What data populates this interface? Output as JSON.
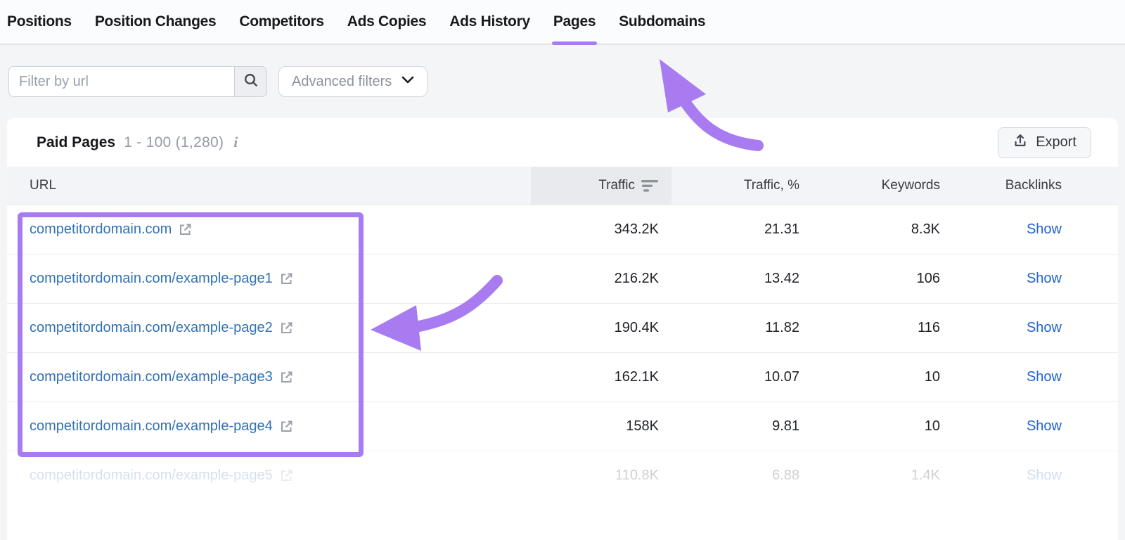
{
  "nav": {
    "tabs": [
      {
        "label": "Positions",
        "active": false
      },
      {
        "label": "Position Changes",
        "active": false
      },
      {
        "label": "Competitors",
        "active": false
      },
      {
        "label": "Ads Copies",
        "active": false
      },
      {
        "label": "Ads History",
        "active": false
      },
      {
        "label": "Pages",
        "active": true
      },
      {
        "label": "Subdomains",
        "active": false
      }
    ]
  },
  "filters": {
    "url_filter_placeholder": "Filter by url",
    "url_filter_value": "",
    "search_icon": "magnifier-icon",
    "advanced_filters_label": "Advanced filters",
    "advanced_filters_icon": "chevron-down-icon"
  },
  "table": {
    "title": "Paid Pages",
    "range_label": "1 - 100 (1,280)",
    "info_icon": "info-icon",
    "export_label": "Export",
    "export_icon": "upload-icon",
    "columns": {
      "url": "URL",
      "traffic": "Traffic",
      "traffic_pct": "Traffic, %",
      "keywords": "Keywords",
      "backlinks": "Backlinks"
    },
    "sorted_by": "Traffic",
    "sort_icon": "sort-descending-icon",
    "external_link_icon": "external-link-icon",
    "rows": [
      {
        "url": "competitordomain.com",
        "traffic": "343.2K",
        "traffic_pct": "21.31",
        "keywords": "8.3K",
        "backlinks_label": "Show"
      },
      {
        "url": "competitordomain.com/example-page1",
        "traffic": "216.2K",
        "traffic_pct": "13.42",
        "keywords": "106",
        "backlinks_label": "Show"
      },
      {
        "url": "competitordomain.com/example-page2",
        "traffic": "190.4K",
        "traffic_pct": "11.82",
        "keywords": "116",
        "backlinks_label": "Show"
      },
      {
        "url": "competitordomain.com/example-page3",
        "traffic": "162.1K",
        "traffic_pct": "10.07",
        "keywords": "10",
        "backlinks_label": "Show"
      },
      {
        "url": "competitordomain.com/example-page4",
        "traffic": "158K",
        "traffic_pct": "9.81",
        "keywords": "10",
        "backlinks_label": "Show"
      },
      {
        "url": "competitordomain.com/example-page5",
        "traffic": "110.8K",
        "traffic_pct": "6.88",
        "keywords": "1.4K",
        "backlinks_label": "Show"
      }
    ]
  },
  "annotations": {
    "elements": [
      "arrow-to-pages-tab",
      "arrow-to-url-list",
      "box-around-top-urls"
    ],
    "highlight_color": "#a87cf0"
  },
  "colors": {
    "link_blue": "#3372b5",
    "show_link_blue": "#2062d4",
    "accent_purple": "#a87cf0",
    "header_row_bg": "#f3f4f7",
    "sorted_column_bg": "#e8eaee"
  }
}
